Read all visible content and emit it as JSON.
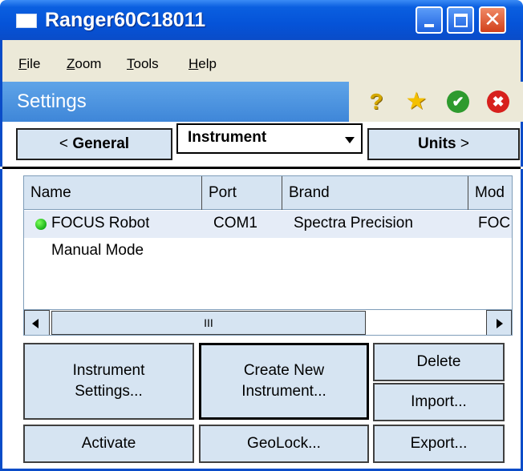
{
  "window": {
    "title": "Ranger60C18011",
    "controls": {
      "minimize": "minimize",
      "maximize": "maximize",
      "close": "✕"
    }
  },
  "menu": {
    "items": [
      "File",
      "Zoom",
      "Tools",
      "Help"
    ]
  },
  "header": {
    "title": "Settings",
    "tools": [
      {
        "icon": "help-icon",
        "glyph": "?"
      },
      {
        "icon": "favorites-star-icon",
        "glyph": "★"
      },
      {
        "icon": "ok-check-icon",
        "glyph": "✔"
      },
      {
        "icon": "cancel-x-icon",
        "glyph": "✖"
      }
    ]
  },
  "nav": {
    "prev_arrow": "<",
    "prev_label": "General",
    "dropdown_value": "Instrument",
    "next_label": "Units",
    "next_arrow": ">"
  },
  "instrument_list": {
    "columns": [
      "Name",
      "Port",
      "Brand",
      "Mod"
    ],
    "rows": [
      {
        "name": "FOCUS Robot",
        "port": "COM1",
        "brand": "Spectra Precision",
        "model": "FOC",
        "active": true
      },
      {
        "name": "Manual Mode",
        "port": "",
        "brand": "",
        "model": "",
        "active": false
      }
    ],
    "scrollbar_thumb": "III"
  },
  "buttons": {
    "instrument_settings": "Instrument\nSettings...",
    "create_new": "Create New\nInstrument...",
    "delete": "Delete",
    "import": "Import...",
    "activate": "Activate",
    "geolock": "GeoLock...",
    "export": "Export..."
  },
  "colors": {
    "title_bar": "#0553d8",
    "settings_bar": "#3e86d8",
    "button_face": "#d6e4f2",
    "active_dot": "#19b219"
  }
}
